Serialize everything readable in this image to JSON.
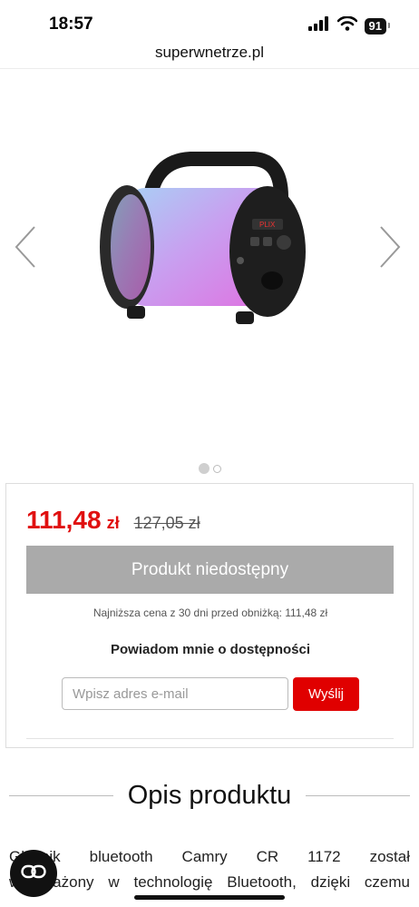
{
  "status": {
    "time": "18:57",
    "battery": "91"
  },
  "browser": {
    "url": "superwnetrze.pl"
  },
  "gallery": {
    "prev_icon": "chevron-left-icon",
    "next_icon": "chevron-right-icon",
    "slide_count": 2,
    "active_slide": 1
  },
  "product": {
    "price": "111,48",
    "price_currency": "zł",
    "old_price": "127,05 zł",
    "unavailable_label": "Produkt niedostępny",
    "lowest_price_note": "Najniższa cena z 30 dni przed obniżką: 111,48 zł",
    "notify_title": "Powiadom mnie o dostępności",
    "email_placeholder": "Wpisz adres e-mail",
    "send_label": "Wyślij"
  },
  "description": {
    "heading": "Opis produktu",
    "line1": "Głośnik bluetooth Camry CR 1172 został",
    "line2": "wyposażony w technologię Bluetooth, dzięki czemu"
  },
  "colors": {
    "accent": "#e01010",
    "button_disabled": "#aaaaaa"
  }
}
